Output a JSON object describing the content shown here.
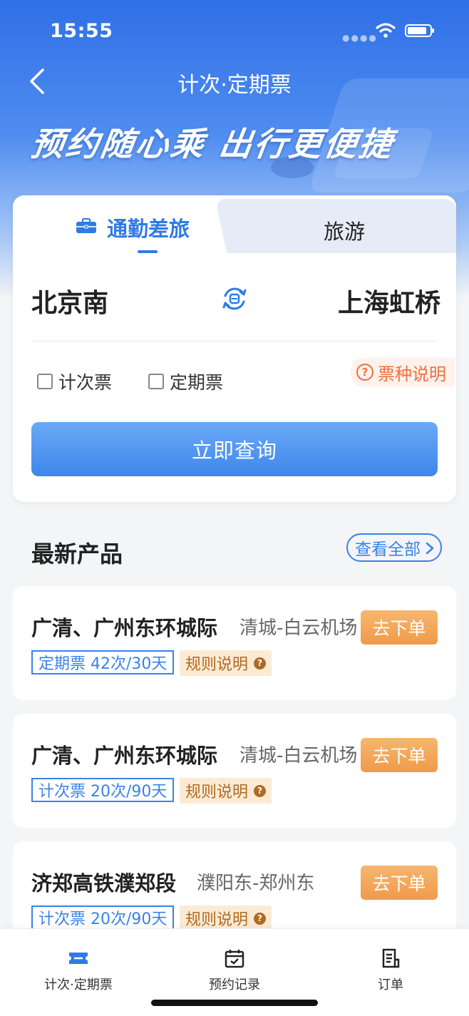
{
  "status_bar": {
    "time": "15:55"
  },
  "nav": {
    "title": "计次·定期票"
  },
  "hero": {
    "slogan": "预约随心乘 出行更便捷"
  },
  "search": {
    "tabs": [
      {
        "label": "通勤差旅",
        "active": true,
        "icon": "briefcase-icon"
      },
      {
        "label": "旅游",
        "active": false
      }
    ],
    "from_station": "北京南",
    "to_station": "上海虹桥",
    "options": [
      {
        "label": "计次票",
        "checked": false
      },
      {
        "label": "定期票",
        "checked": false
      }
    ],
    "ticket_info_label": "票种说明",
    "query_button": "立即查询"
  },
  "products": {
    "title": "最新产品",
    "view_all": "查看全部",
    "items": [
      {
        "name": "广清、广州东环城际",
        "route": "清城-白云机场",
        "tag": "定期票 42次/30天",
        "rule": "规则说明",
        "order": "去下单"
      },
      {
        "name": "广清、广州东环城际",
        "route": "清城-白云机场",
        "tag": "计次票 20次/90天",
        "rule": "规则说明",
        "order": "去下单"
      },
      {
        "name": "济郑高铁濮郑段",
        "route": "濮阳东-郑州东",
        "tag": "计次票 20次/90天",
        "rule": "规则说明",
        "order": "去下单"
      }
    ]
  },
  "bottom_nav": [
    {
      "label": "计次·定期票",
      "icon": "ticket-icon",
      "active": true
    },
    {
      "label": "预约记录",
      "icon": "calendar-check-icon",
      "active": false
    },
    {
      "label": "订单",
      "icon": "order-list-icon",
      "active": false
    }
  ],
  "colors": {
    "primary": "#2f7ae5",
    "accent_orange": "#f09a4a",
    "info_orange": "#f0703d"
  }
}
